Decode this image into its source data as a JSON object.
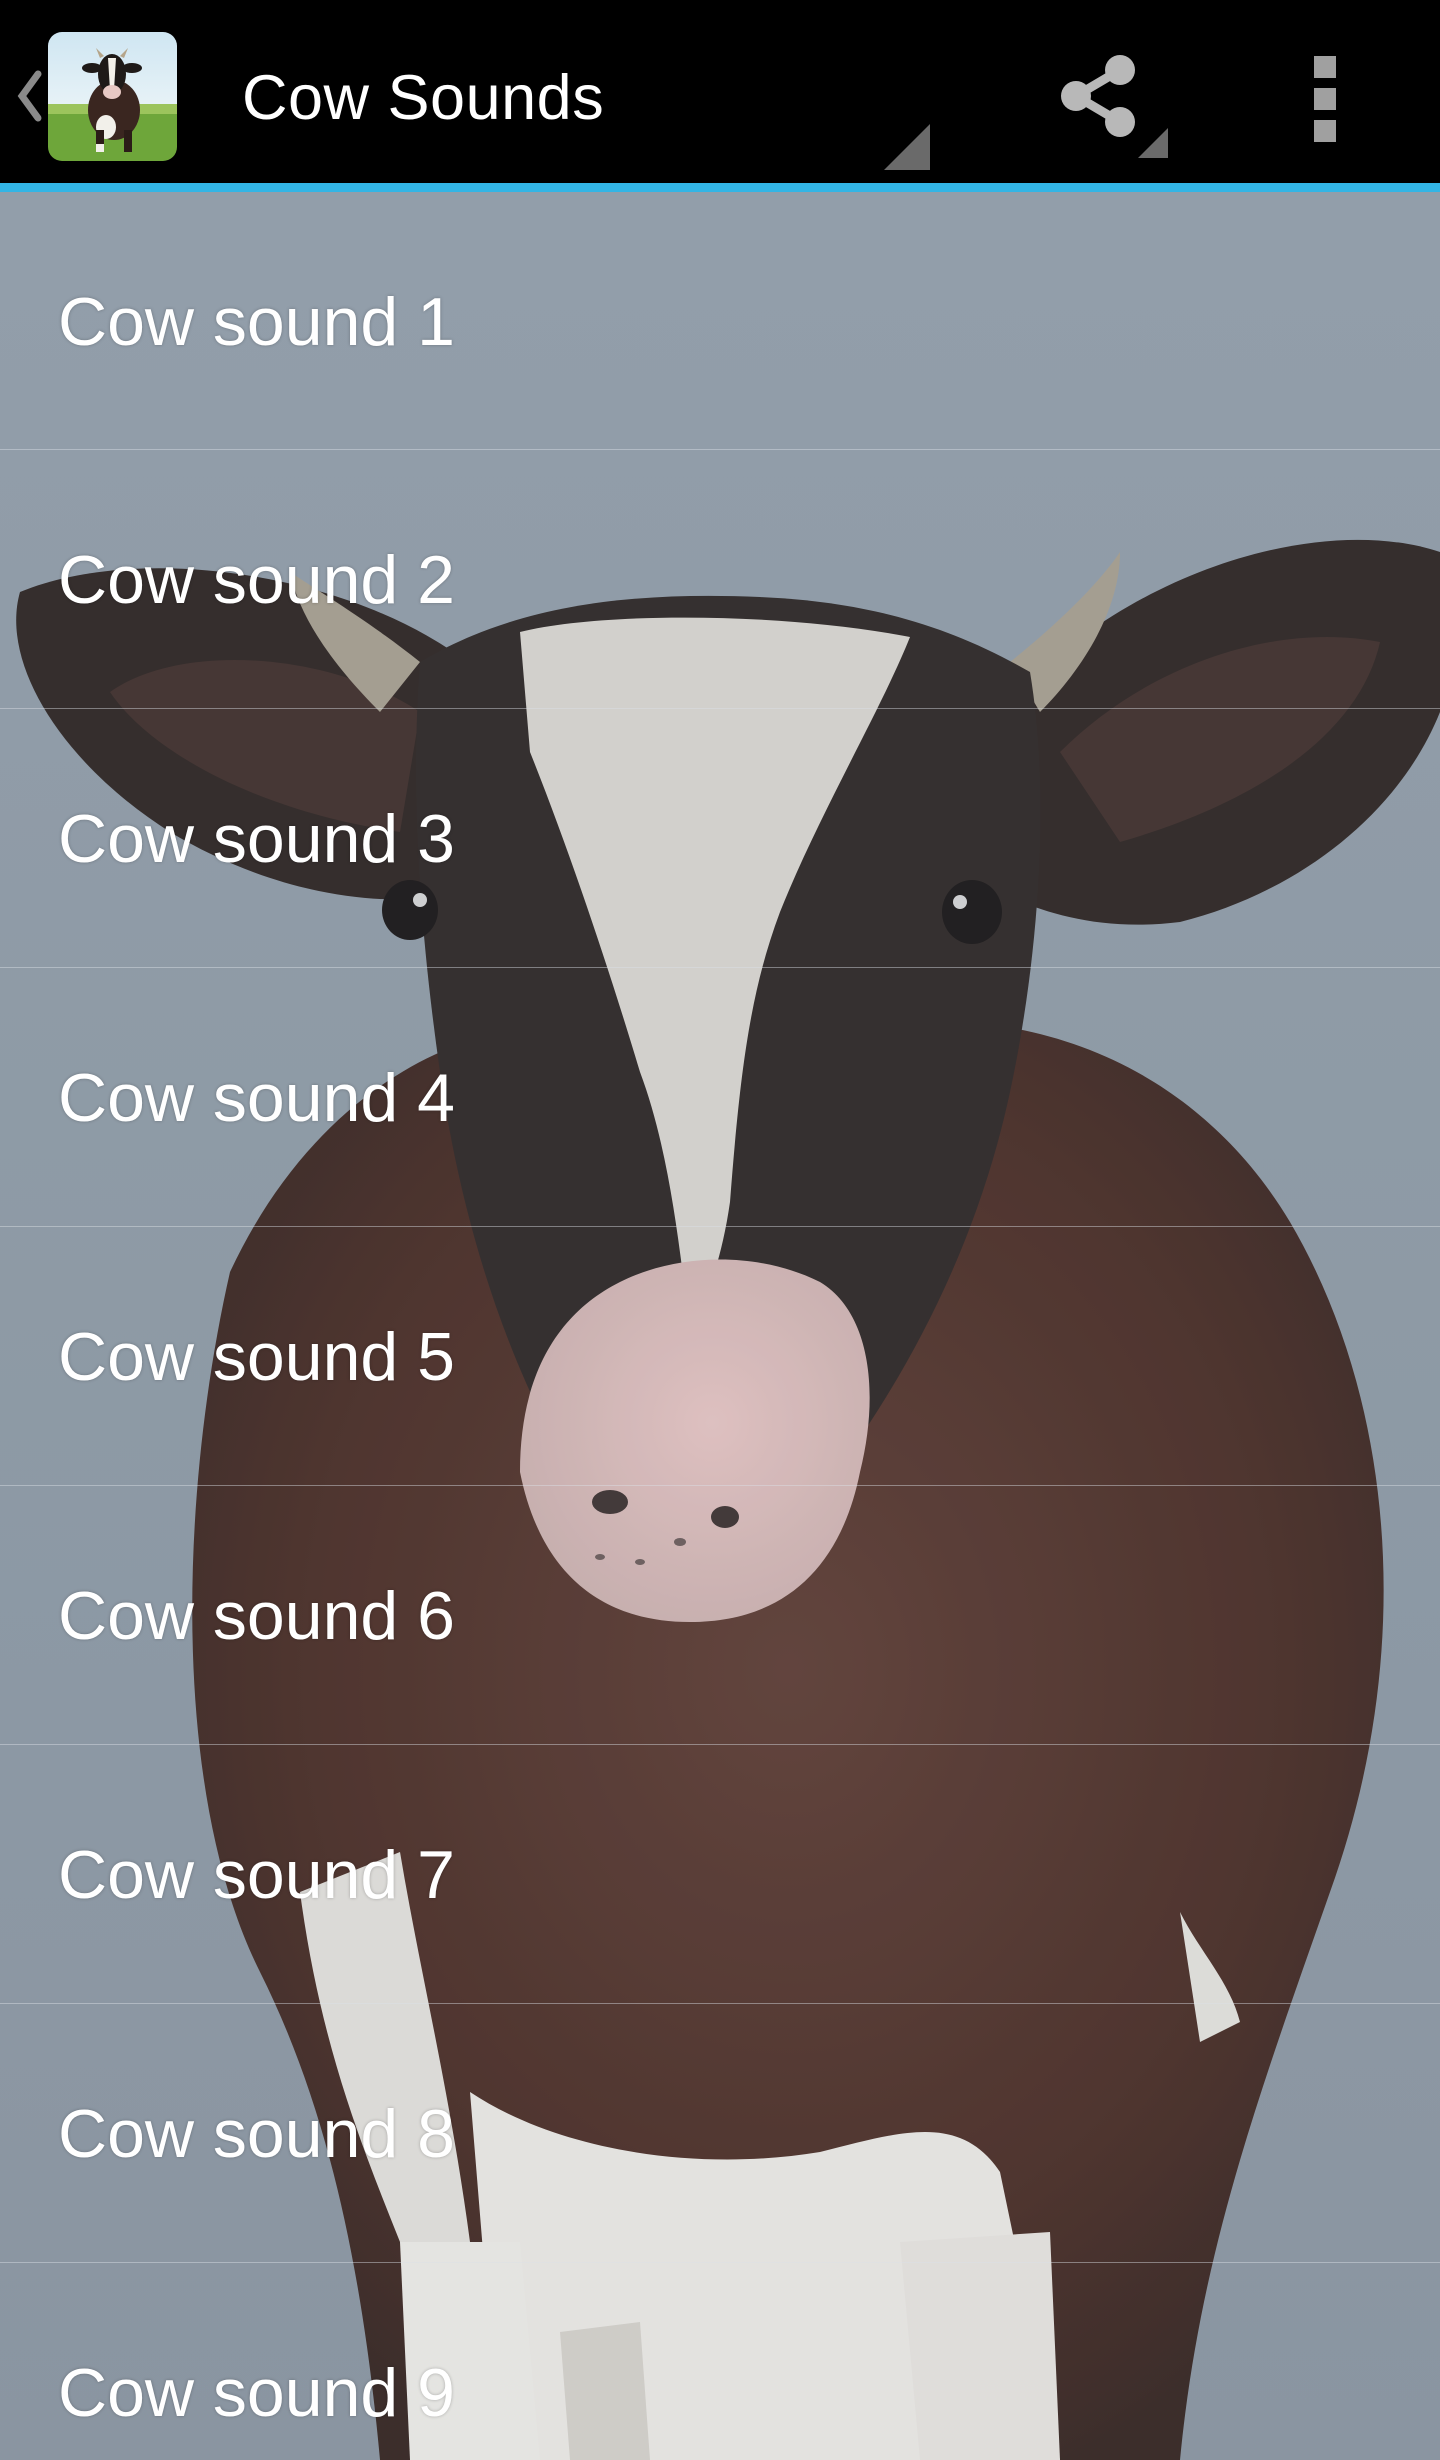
{
  "action_bar": {
    "title": "Cow Sounds",
    "app_icon": "cow-app-icon",
    "up_icon": "up-caret-icon",
    "share_icon": "share-icon",
    "overflow_icon": "overflow-menu-icon",
    "accent_color": "#33b5e5",
    "background_color": "#000000"
  },
  "background": {
    "image": "cow-photo",
    "sky_color": "#8c98a3"
  },
  "sounds": {
    "items": [
      {
        "label": "Cow sound 1"
      },
      {
        "label": "Cow sound 2"
      },
      {
        "label": "Cow sound 3"
      },
      {
        "label": "Cow sound 4"
      },
      {
        "label": "Cow sound 5"
      },
      {
        "label": "Cow sound 6"
      },
      {
        "label": "Cow sound 7"
      },
      {
        "label": "Cow sound 8"
      },
      {
        "label": "Cow sound 9"
      }
    ]
  }
}
